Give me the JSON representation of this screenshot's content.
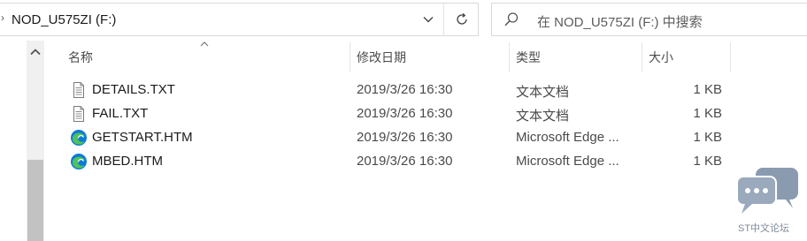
{
  "address_bar": {
    "path": "NOD_U575ZI (F:)"
  },
  "search": {
    "placeholder": "在 NOD_U575ZI (F:) 中搜索"
  },
  "columns": {
    "name": "名称",
    "modified": "修改日期",
    "type": "类型",
    "size": "大小",
    "sorted_by": "名称"
  },
  "files": [
    {
      "name": "DETAILS.TXT",
      "modified": "2019/3/26 16:30",
      "type": "文本文档",
      "size": "1 KB",
      "icon": "text-file-icon"
    },
    {
      "name": "FAIL.TXT",
      "modified": "2019/3/26 16:30",
      "type": "文本文档",
      "size": "1 KB",
      "icon": "text-file-icon"
    },
    {
      "name": "GETSTART.HTM",
      "modified": "2019/3/26 16:30",
      "type": "Microsoft Edge ...",
      "size": "1 KB",
      "icon": "edge-icon"
    },
    {
      "name": "MBED.HTM",
      "modified": "2019/3/26 16:30",
      "type": "Microsoft Edge ...",
      "size": "1 KB",
      "icon": "edge-icon"
    }
  ],
  "watermark": {
    "text": "ST中文论坛"
  },
  "colors": {
    "edge_blue": "#0c7bd6",
    "edge_green": "#4fc25f",
    "watermark": "#8a9bb0"
  }
}
